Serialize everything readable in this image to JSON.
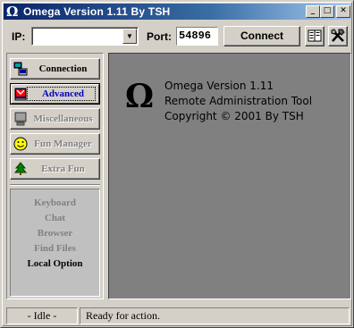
{
  "window": {
    "title": "Omega Version 1.11 By TSH",
    "title_icon": "Ω",
    "controls": {
      "minimize": "_",
      "maximize": "□",
      "close": "✕"
    }
  },
  "toolbar": {
    "ip_label": "IP:",
    "ip_value": "",
    "port_label": "Port:",
    "port_value": "54896",
    "connect_label": "Connect",
    "dropdown_arrow": "▼",
    "icons": [
      "address-book-icon",
      "tools-icon"
    ]
  },
  "nav": {
    "items": [
      {
        "label": "Connection",
        "icon": "computers-icon",
        "state": "enabled"
      },
      {
        "label": "Advanced",
        "icon": "flag-icon",
        "state": "active"
      },
      {
        "label": "Miscellaneous",
        "icon": "monitor-icon",
        "state": "disabled"
      },
      {
        "label": "Fun Manager",
        "icon": "smiley-icon",
        "state": "disabled"
      },
      {
        "label": "Extra Fun",
        "icon": "tree-icon",
        "state": "disabled"
      }
    ]
  },
  "sub_options": {
    "items": [
      {
        "label": "Keyboard",
        "state": "disabled"
      },
      {
        "label": "Chat",
        "state": "disabled"
      },
      {
        "label": "Browser",
        "state": "disabled"
      },
      {
        "label": "Find Files",
        "state": "disabled"
      },
      {
        "label": "Local Option",
        "state": "enabled"
      }
    ]
  },
  "about": {
    "logo": "Ω",
    "line1": "Omega Version 1.11",
    "line2": "Remote Administration Tool",
    "line3": "Copyright © 2001 By TSH"
  },
  "status": {
    "idle": "- Idle -",
    "message": "Ready for action."
  },
  "colors": {
    "titlebar_start": "#0a246a",
    "titlebar_end": "#a6caf0",
    "face": "#d4d0c8",
    "content_bg": "#808080",
    "active_label": "#0000c0"
  }
}
